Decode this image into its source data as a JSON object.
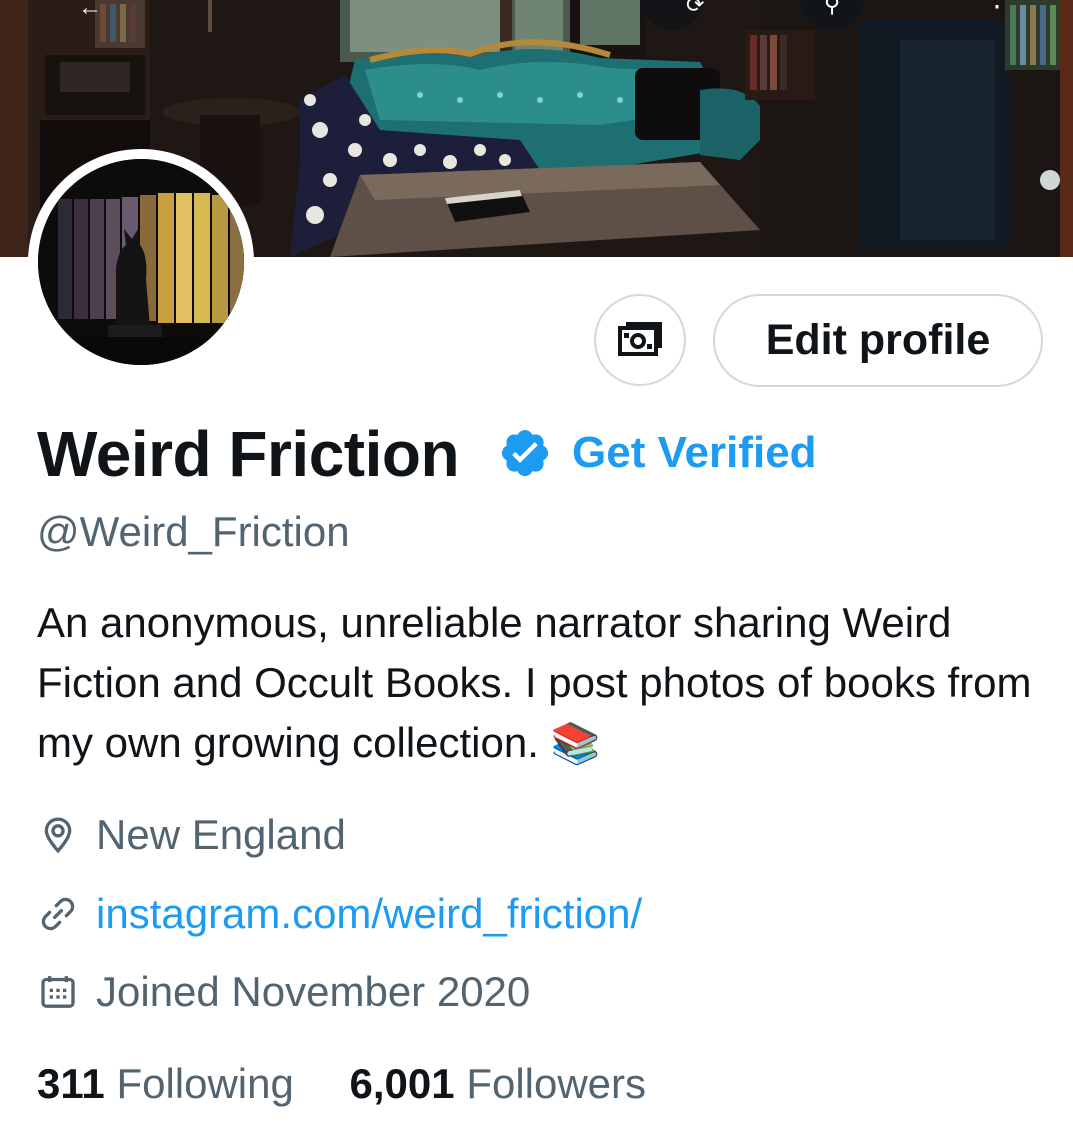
{
  "header": {
    "top_icons": [
      "back-arrow-icon",
      "history-icon",
      "search-icon",
      "more-icon"
    ]
  },
  "profile": {
    "name": "Weird Friction",
    "verified_badge_color": "#1d9bf0",
    "get_verified_label": "Get Verified",
    "handle": "@Weird_Friction",
    "bio": "An anonymous, unreliable narrator sharing Weird Fiction and Occult Books. I post photos of books from my own growing collection.",
    "bio_emoji": "📚",
    "location": "New England",
    "website": "instagram.com/weird_friction/",
    "joined": "Joined November 2020"
  },
  "actions": {
    "money_icon": "money-icon",
    "edit_profile_label": "Edit profile"
  },
  "stats": {
    "following_count": "311",
    "following_label": "Following",
    "followers_count": "6,001",
    "followers_label": "Followers"
  },
  "colors": {
    "accent": "#1d9bf0",
    "secondary_text": "#536471",
    "primary_text": "#0f1419",
    "border": "#cfd9de"
  }
}
